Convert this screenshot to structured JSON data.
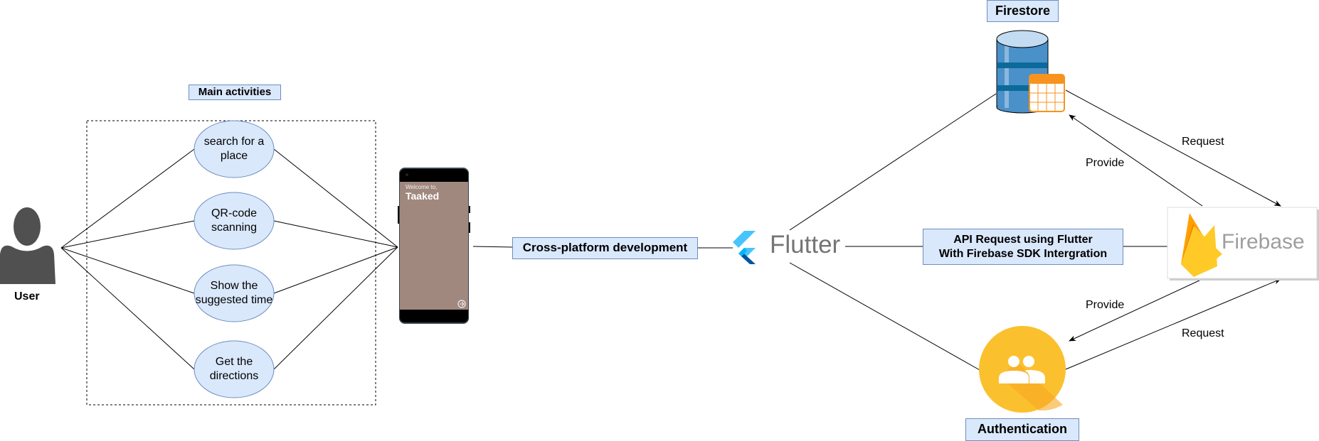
{
  "actor": {
    "label": "User"
  },
  "use_case_group": {
    "title": "Main activities",
    "use_cases": [
      {
        "label": "search for a place"
      },
      {
        "label": "QR-code scanning"
      },
      {
        "label": "Show the suggested time"
      },
      {
        "label": "Get the directions"
      }
    ]
  },
  "phone": {
    "welcome": "Welcome to,",
    "app_name": "Taaked",
    "screen_color": "#a1887f"
  },
  "connector_labels": {
    "cross_platform": "Cross-platform development",
    "api_request_line1": "API Request using Flutter",
    "api_request_line2": "With Firebase SDK Intergration"
  },
  "flutter": {
    "label": "Flutter"
  },
  "firebase": {
    "label": "Firebase"
  },
  "firestore": {
    "label": "Firestore"
  },
  "authentication": {
    "label": "Authentication"
  },
  "edges": {
    "firestore_request": "Request",
    "firestore_provide": "Provide",
    "auth_provide": "Provide",
    "auth_request": "Request"
  },
  "colors": {
    "label_fill": "#dae8fc",
    "label_border": "#6c8ebf",
    "auth_yellow": "#fbc02d",
    "firestore_blue": "#4a90c9",
    "table_orange": "#f7931e"
  }
}
